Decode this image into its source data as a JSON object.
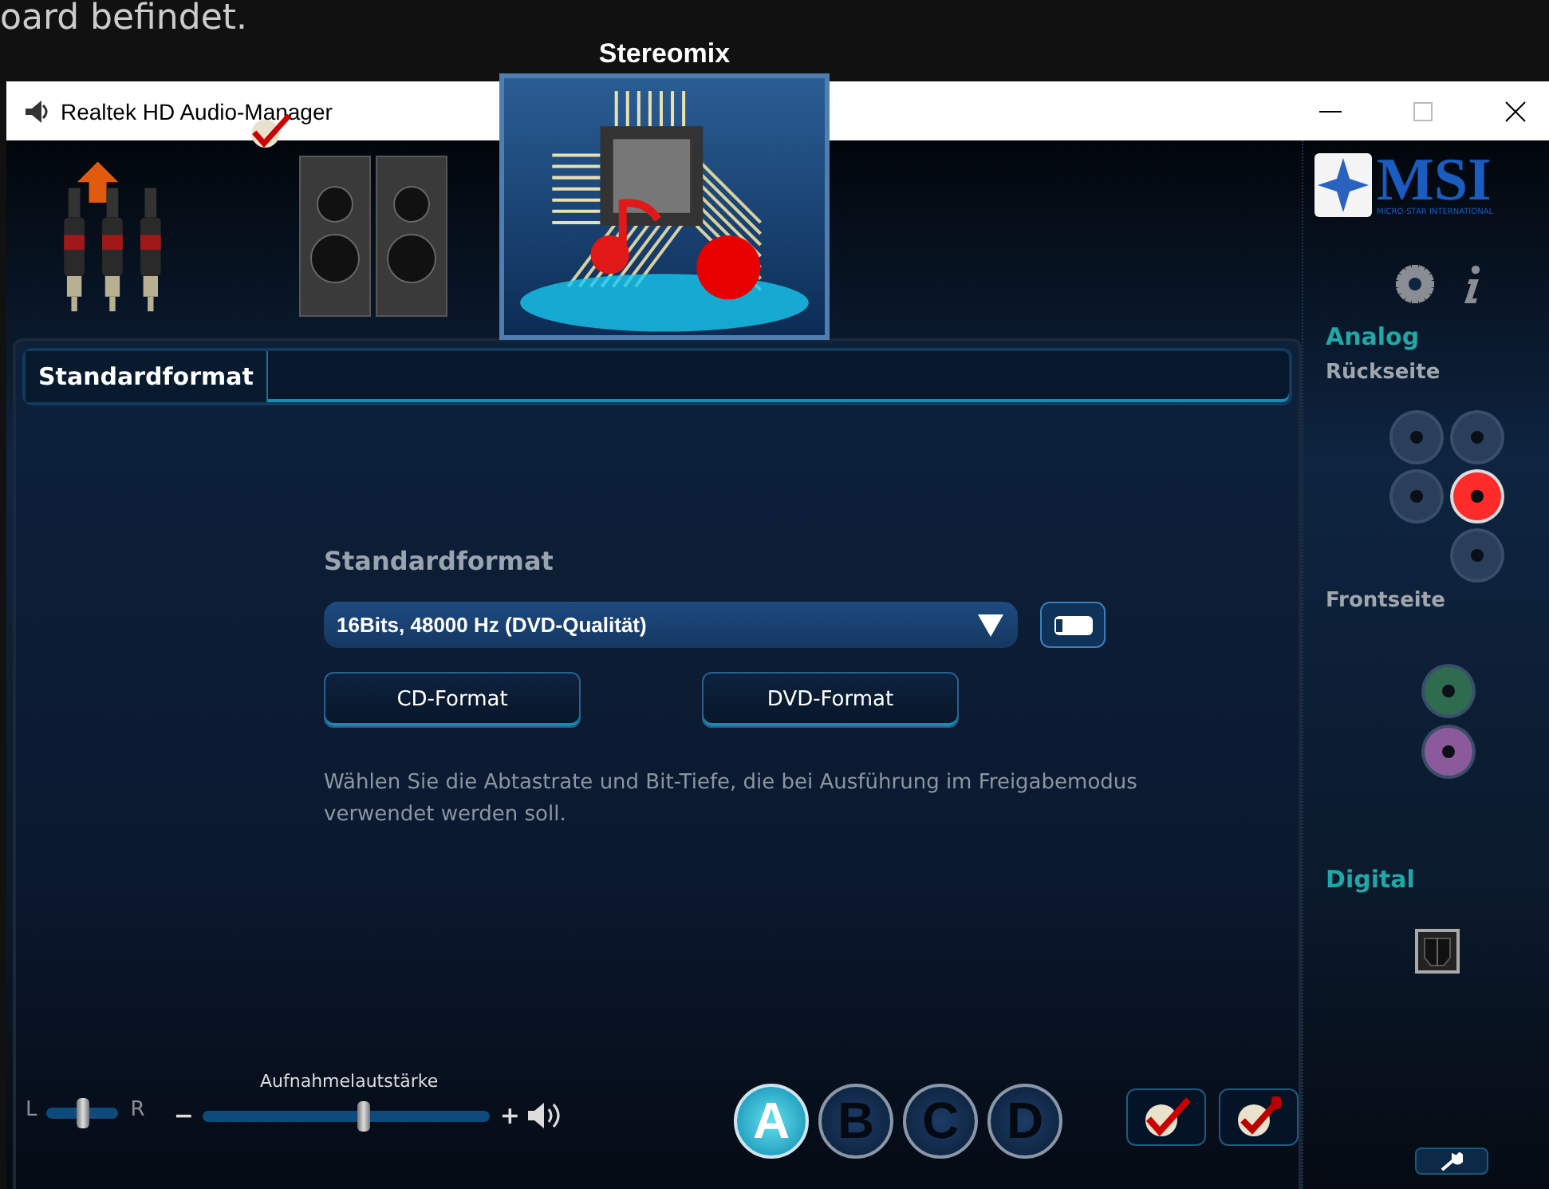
{
  "background_text": "oard befindet.",
  "window": {
    "title": "Realtek HD Audio-Manager"
  },
  "devices": [
    {
      "kind": "line-in",
      "selected": false,
      "default": false
    },
    {
      "kind": "speakers",
      "selected": false,
      "default": true
    },
    {
      "kind": "stereomix",
      "label": "Stereomix",
      "selected": true,
      "default": false
    }
  ],
  "tabs": [
    {
      "label": "Standardformat",
      "selected": true
    }
  ],
  "format": {
    "heading": "Standardformat",
    "dropdown_value": "16Bits, 48000 Hz (DVD-Qualität)",
    "buttons": [
      "CD-Format",
      "DVD-Format"
    ],
    "description": "Wählen Sie die Abtastrate und Bit-Tiefe, die bei Ausführung im Freigabemodus verwendet werden soll."
  },
  "balance": {
    "left": "L",
    "right": "R",
    "level": 0.5
  },
  "volume": {
    "label": "Aufnahmelautstärke",
    "minus": "−",
    "plus": "+",
    "level": 0.56
  },
  "profiles": [
    {
      "label": "A",
      "selected": true
    },
    {
      "label": "B",
      "selected": false
    },
    {
      "label": "C",
      "selected": false
    },
    {
      "label": "D",
      "selected": false
    }
  ],
  "sidebar": {
    "logo": {
      "text": "MSI",
      "tagline": "MICRO-STAR INTERNATIONAL"
    },
    "analog": "Analog",
    "rear": "Rückseite",
    "rear_jacks": [
      {
        "color": "#2b3f5c",
        "connected": false
      },
      {
        "color": "#2b3f5c",
        "connected": false
      },
      {
        "color": "#2b3f5c",
        "connected": false
      },
      {
        "color": "#ff2a2a",
        "connected": true
      },
      {
        "color": "#2b3f5c",
        "connected": false
      }
    ],
    "front": "Frontseite",
    "front_jacks": [
      {
        "color": "#2e6b4f",
        "connected": false
      },
      {
        "color": "#8a5a9a",
        "connected": false
      }
    ],
    "digital": "Digital"
  }
}
